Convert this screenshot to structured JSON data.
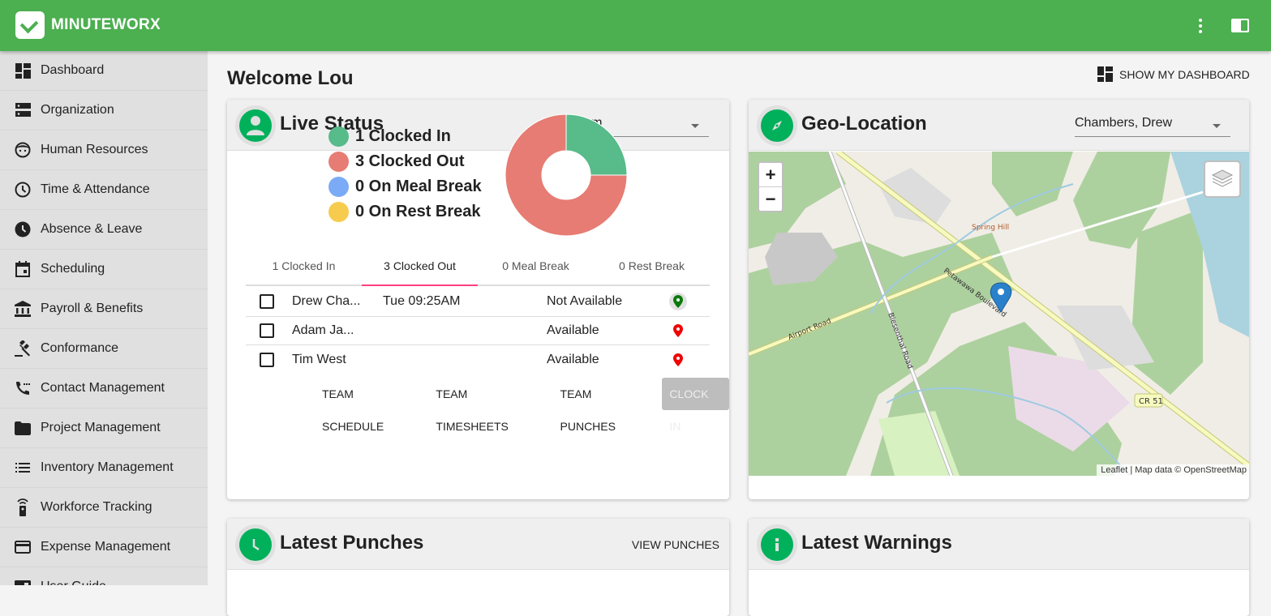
{
  "app": {
    "brand": "MINUTEWORX"
  },
  "topbar": {
    "more_icon": "more-vert-icon",
    "panel_icon": "side-panel-icon"
  },
  "sidebar": {
    "items": [
      {
        "label": "Dashboard",
        "icon": "dashboard-icon"
      },
      {
        "label": "Organization",
        "icon": "dns-icon"
      },
      {
        "label": "Human Resources",
        "icon": "face-icon"
      },
      {
        "label": "Time & Attendance",
        "icon": "clock-outline-icon"
      },
      {
        "label": "Absence & Leave",
        "icon": "clock-filled-icon"
      },
      {
        "label": "Scheduling",
        "icon": "calendar-icon"
      },
      {
        "label": "Payroll & Benefits",
        "icon": "bank-icon"
      },
      {
        "label": "Conformance",
        "icon": "gavel-icon"
      },
      {
        "label": "Contact Management",
        "icon": "phone-icon"
      },
      {
        "label": "Project Management",
        "icon": "folder-icon"
      },
      {
        "label": "Inventory Management",
        "icon": "list-icon"
      },
      {
        "label": "Workforce Tracking",
        "icon": "remote-icon"
      },
      {
        "label": "Expense Management",
        "icon": "credit-card-icon"
      },
      {
        "label": "User Guide",
        "icon": "guide-icon"
      }
    ]
  },
  "main": {
    "welcome": "Welcome Lou",
    "show_dashboard": "SHOW MY DASHBOARD"
  },
  "live_status": {
    "title": "Live Status",
    "team_select": "MyTeam",
    "legend": [
      {
        "label": "1 Clocked In",
        "color": "#57bb8a"
      },
      {
        "label": "3 Clocked Out",
        "color": "#e67c73"
      },
      {
        "label": "0 On Meal Break",
        "color": "#7baaf7"
      },
      {
        "label": "0 On Rest Break",
        "color": "#f7cb4d"
      }
    ],
    "tabs": [
      "1 Clocked In",
      "3 Clocked Out",
      "0 Meal Break",
      "0 Rest Break"
    ],
    "active_tab": 1,
    "rows": [
      {
        "name": "Drew Cha...",
        "time": "Tue 09:25AM",
        "availability": "Not Available",
        "pin_color": "#0a7a0a"
      },
      {
        "name": "Adam Ja...",
        "time": "",
        "availability": "Available",
        "pin_color": "#f00000"
      },
      {
        "name": "Tim West",
        "time": "",
        "availability": "Available",
        "pin_color": "#f00000"
      }
    ],
    "actions": {
      "team_schedule": "TEAM SCHEDULE",
      "team_timesheets": "TEAM TIMESHEETS",
      "team_punches": "TEAM PUNCHES",
      "clock_in": "CLOCK IN"
    }
  },
  "chart_data": {
    "type": "pie",
    "title": "Live Status",
    "categories": [
      "Clocked In",
      "Clocked Out",
      "On Meal Break",
      "On Rest Break"
    ],
    "values": [
      1,
      3,
      0,
      0
    ],
    "colors": [
      "#57bb8a",
      "#e67c73",
      "#7baaf7",
      "#f7cb4d"
    ],
    "donut": true,
    "legend": "left"
  },
  "geo": {
    "title": "Geo-Location",
    "employee_select": "Chambers, Drew",
    "zoom_in": "+",
    "zoom_out": "−",
    "attribution": "Leaflet | Map data © OpenStreetMap",
    "labels": {
      "road1": "Petawawa Boulevard",
      "road2": "Airport Road",
      "road3": "Biesenthal Road",
      "place": "Spring Hill",
      "route": "CR 51"
    }
  },
  "latest_punches": {
    "title": "Latest Punches",
    "view": "VIEW PUNCHES"
  },
  "latest_warnings": {
    "title": "Latest Warnings"
  }
}
